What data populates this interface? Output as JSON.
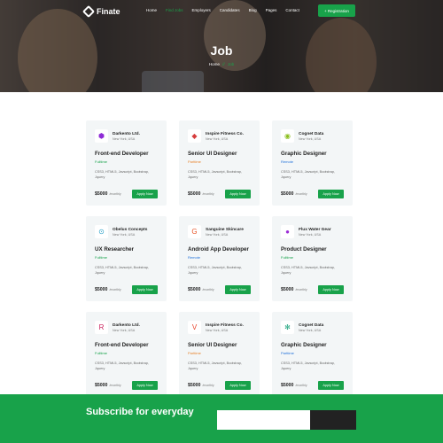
{
  "header": {
    "logo_text": "Finate",
    "nav": [
      {
        "label": "Home",
        "active": false
      },
      {
        "label": "Find Jobs",
        "active": true
      },
      {
        "label": "Employers",
        "active": false
      },
      {
        "label": "Candidates",
        "active": false
      },
      {
        "label": "Blog",
        "active": false
      },
      {
        "label": "Pages",
        "active": false
      },
      {
        "label": "Contact",
        "active": false
      }
    ],
    "register_label": "+ Registration"
  },
  "hero": {
    "title": "Job",
    "breadcrumb": {
      "home": "Home",
      "separator": "//",
      "current": "Job"
    }
  },
  "colors": {
    "accent": "#18a24a",
    "fulltime": "#18a24a",
    "parttime": "#e8822a",
    "remote": "#1e6fd9"
  },
  "jobs": [
    {
      "company": "Darkento Ltd.",
      "location": "New York, USA",
      "title": "Front-end Developer",
      "type": "Fulltime",
      "type_color": "#18a24a",
      "skills": "CSS3, HTML5, Javscript, Bootstrap, Jquery",
      "salary": "$5000",
      "period": "/monthly",
      "apply": "Apply Now",
      "logo_icon": "hexagon-logo-icon",
      "logo_glyph": "⬢",
      "logo_color": "#8e2bd6"
    },
    {
      "company": "Inspire Fitness Co.",
      "location": "New York, USA",
      "title": "Senior UI Designer",
      "type": "Parttime",
      "type_color": "#e8822a",
      "skills": "CSS3, HTML5, Javscript, Bootstrap, Jquery",
      "salary": "$5000",
      "period": "/monthly",
      "apply": "Apply Now",
      "logo_icon": "diamond-logo-icon",
      "logo_glyph": "◆",
      "logo_color": "#d63c3c"
    },
    {
      "company": "Cognet Data",
      "location": "New York, USA",
      "title": "Graphic Designer",
      "type": "Remote",
      "type_color": "#1e6fd9",
      "skills": "CSS3, HTML5, Javscript, Bootstrap, Jquery",
      "salary": "$5000",
      "period": "/monthly",
      "apply": "Apply Now",
      "logo_icon": "circle-logo-icon",
      "logo_glyph": "◉",
      "logo_color": "#8bbf1e"
    },
    {
      "company": "Obelus Concepts",
      "location": "New York, USA",
      "title": "UX Researcher",
      "type": "Fulltime",
      "type_color": "#18a24a",
      "skills": "CSS3, HTML5, Javscript, Bootstrap, Jquery",
      "salary": "$5000",
      "period": "/monthly",
      "apply": "Apply Now",
      "logo_icon": "search-logo-icon",
      "logo_glyph": "⊙",
      "logo_color": "#2aa0c8"
    },
    {
      "company": "Sanguine Skincare",
      "location": "New York, USA",
      "title": "Android App Developer",
      "type": "Remote",
      "type_color": "#1e6fd9",
      "skills": "CSS3, HTML5, Javscript, Bootstrap, Jquery",
      "salary": "$5000",
      "period": "/monthly",
      "apply": "Apply Now",
      "logo_icon": "g-letter-logo-icon",
      "logo_glyph": "G",
      "logo_color": "#e8562a"
    },
    {
      "company": "Flux Water Gear",
      "location": "New York, USA",
      "title": "Product Designer",
      "type": "Fulltime",
      "type_color": "#18a24a",
      "skills": "CSS3, HTML5, Javscript, Bootstrap, Jquery",
      "salary": "$5000",
      "period": "/monthly",
      "apply": "Apply Now",
      "logo_icon": "f-letter-logo-icon",
      "logo_glyph": "●",
      "logo_color": "#9b2bd6"
    },
    {
      "company": "Darkento Ltd.",
      "location": "New York, USA",
      "title": "Front-end Developer",
      "type": "Fulltime",
      "type_color": "#18a24a",
      "skills": "CSS3, HTML5, Javscript, Bootstrap, Jquery",
      "salary": "$5000",
      "period": "/monthly",
      "apply": "Apply Now",
      "logo_icon": "r-letter-logo-icon",
      "logo_glyph": "R",
      "logo_color": "#c81e5a"
    },
    {
      "company": "Inspire Fitness Co.",
      "location": "New York, USA",
      "title": "Senior UI Designer",
      "type": "Parttime",
      "type_color": "#e8822a",
      "skills": "CSS3, HTML5, Javscript, Bootstrap, Jquery",
      "salary": "$5000",
      "period": "/monthly",
      "apply": "Apply Now",
      "logo_icon": "v-letter-logo-icon",
      "logo_glyph": "V",
      "logo_color": "#e8432a"
    },
    {
      "company": "Cognet Data",
      "location": "New York, USA",
      "title": "Graphic Designer",
      "type": "Parttime",
      "type_color": "#1e6fd9",
      "skills": "CSS3, HTML5, Javscript, Bootstrap, Jquery",
      "salary": "$5000",
      "period": "/monthly",
      "apply": "Apply Now",
      "logo_icon": "snowflake-logo-icon",
      "logo_glyph": "✻",
      "logo_color": "#18a27a"
    }
  ],
  "subscribe": {
    "title": "Subscribe for everyday"
  }
}
